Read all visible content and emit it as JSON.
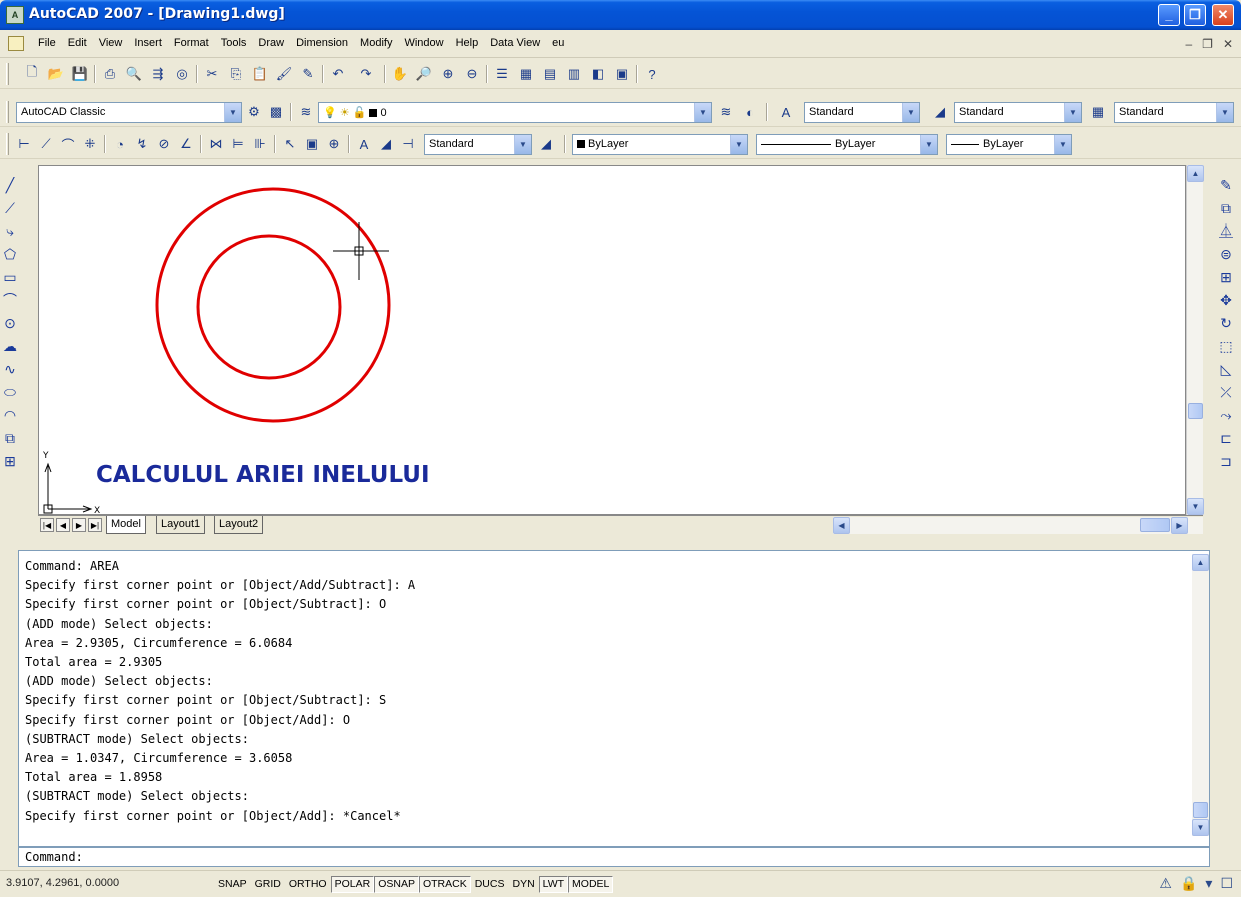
{
  "window": {
    "title": "AutoCAD 2007 - [Drawing1.dwg]",
    "min_glyph": "_",
    "max_glyph": "❐",
    "close_glyph": "✕"
  },
  "menu": [
    "File",
    "Edit",
    "View",
    "Insert",
    "Format",
    "Tools",
    "Draw",
    "Dimension",
    "Modify",
    "Window",
    "Help",
    "Data View",
    "eu"
  ],
  "toolbars": {
    "workspace": "AutoCAD Classic",
    "layer": "0",
    "text_style": "Standard",
    "dim_style": "Standard",
    "table_style": "Standard",
    "dim_style_2": "Standard",
    "color": "ByLayer",
    "linetype": "ByLayer",
    "lineweight": "ByLayer"
  },
  "drawing": {
    "title": "CALCULUL ARIEI INELULUI",
    "ucs_y": "Y",
    "ucs_x": "X",
    "accent": "#e00000"
  },
  "tabs": [
    "Model",
    "Layout1",
    "Layout2"
  ],
  "command_lines": [
    "Command: AREA",
    "Specify first corner point or [Object/Add/Subtract]: A",
    "Specify first corner point or [Object/Subtract]: O",
    "(ADD mode) Select objects:",
    "Area = 2.9305, Circumference = 6.0684",
    "Total area = 2.9305",
    "(ADD mode) Select objects:",
    "Specify first corner point or [Object/Subtract]: S",
    "Specify first corner point or [Object/Add]: O",
    "(SUBTRACT mode) Select objects:",
    "Area = 1.0347, Circumference = 3.6058",
    "Total area = 1.8958",
    "(SUBTRACT mode) Select objects:",
    "Specify first corner point or [Object/Add]: *Cancel*"
  ],
  "command_prompt": "Command:",
  "status": {
    "coords": "3.9107, 4.2961, 0.0000",
    "buttons": [
      {
        "label": "SNAP",
        "on": false
      },
      {
        "label": "GRID",
        "on": false
      },
      {
        "label": "ORTHO",
        "on": false
      },
      {
        "label": "POLAR",
        "on": true
      },
      {
        "label": "OSNAP",
        "on": true
      },
      {
        "label": "OTRACK",
        "on": true
      },
      {
        "label": "DUCS",
        "on": false
      },
      {
        "label": "DYN",
        "on": false
      },
      {
        "label": "LWT",
        "on": true
      },
      {
        "label": "MODEL",
        "on": true
      }
    ]
  }
}
